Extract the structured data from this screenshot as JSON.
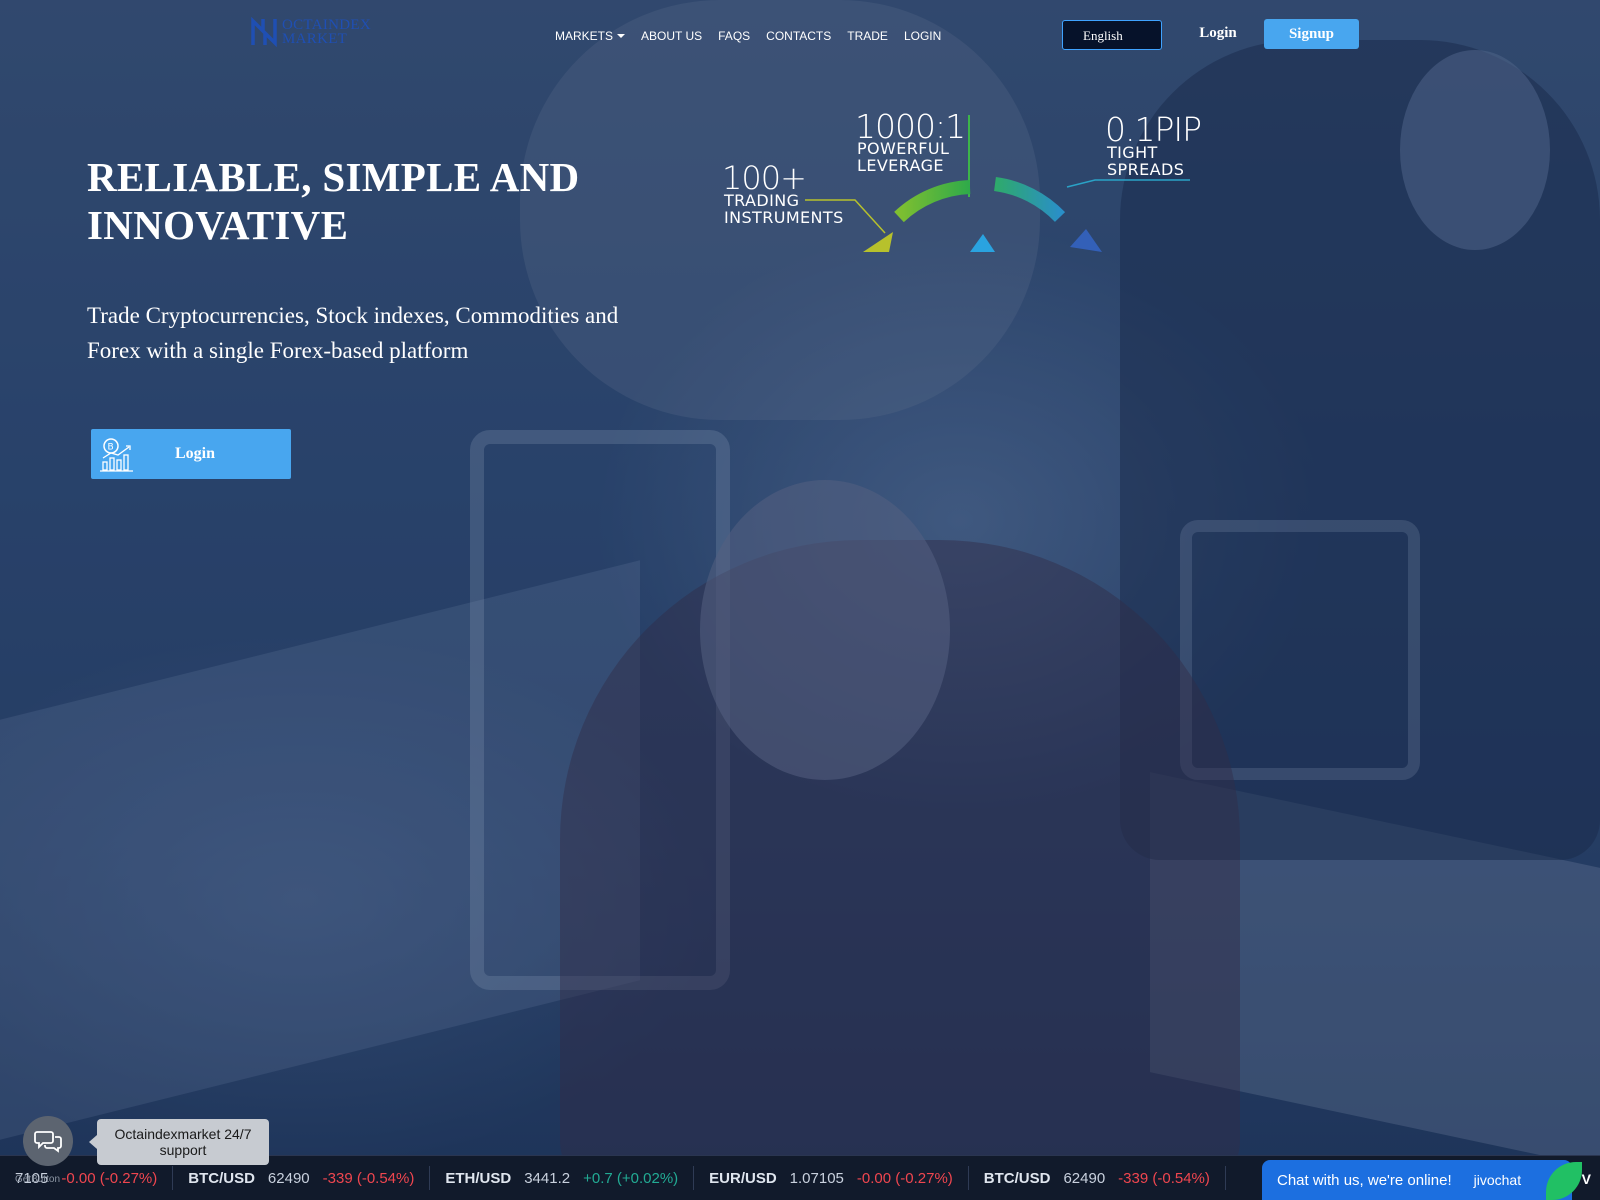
{
  "brand": {
    "logo_line1": "OCTAINDEX",
    "logo_line2": "MARKET",
    "accent_color": "#48a6ef"
  },
  "nav": {
    "items": [
      "MARKETS",
      "ABOUT US",
      "FAQS",
      "CONTACTS",
      "TRADE",
      "LOGIN"
    ]
  },
  "header": {
    "language": "English",
    "login_label": "Login",
    "signup_label": "Signup"
  },
  "hero": {
    "title": "RELIABLE, SIMPLE AND INNOVATIVE",
    "subtitle": "Trade Cryptocurrencies, Stock indexes, Commodities and Forex with a single Forex-based platform",
    "cta_label": "Login"
  },
  "stats": [
    {
      "value": "100+",
      "line1": "TRADING",
      "line2": "INSTRUMENTS",
      "color": "#b7c12c"
    },
    {
      "value": "1000:1",
      "line1": "POWERFUL",
      "line2": "LEVERAGE",
      "color": "#3db54a"
    },
    {
      "value": "0.1PIP",
      "line1": "TIGHT",
      "line2": "SPREADS",
      "color": "#2aa3c7"
    }
  ],
  "ticker": {
    "items": [
      {
        "symbol": "",
        "price": "7105",
        "change": "-0.00 (-0.27%)",
        "direction": "neg"
      },
      {
        "symbol": "BTC/USD",
        "price": "62490",
        "change": "-339 (-0.54%)",
        "direction": "neg"
      },
      {
        "symbol": "ETH/USD",
        "price": "3441.2",
        "change": "+0.7 (+0.02%)",
        "direction": "pos"
      },
      {
        "symbol": "EUR/USD",
        "price": "1.07105",
        "change": "-0.00 (-0.27%)",
        "direction": "neg"
      },
      {
        "symbol": "BTC/USD",
        "price": "62490",
        "change": "-339 (-0.54%)",
        "direction": "neg"
      }
    ],
    "badge": "TV"
  },
  "chat": {
    "tooltip": "Octaindexmarket 24/7 support",
    "getbutton": "GetButton",
    "jivo_text": "Chat with us, we're online!",
    "jivo_brand": "jivochat"
  }
}
